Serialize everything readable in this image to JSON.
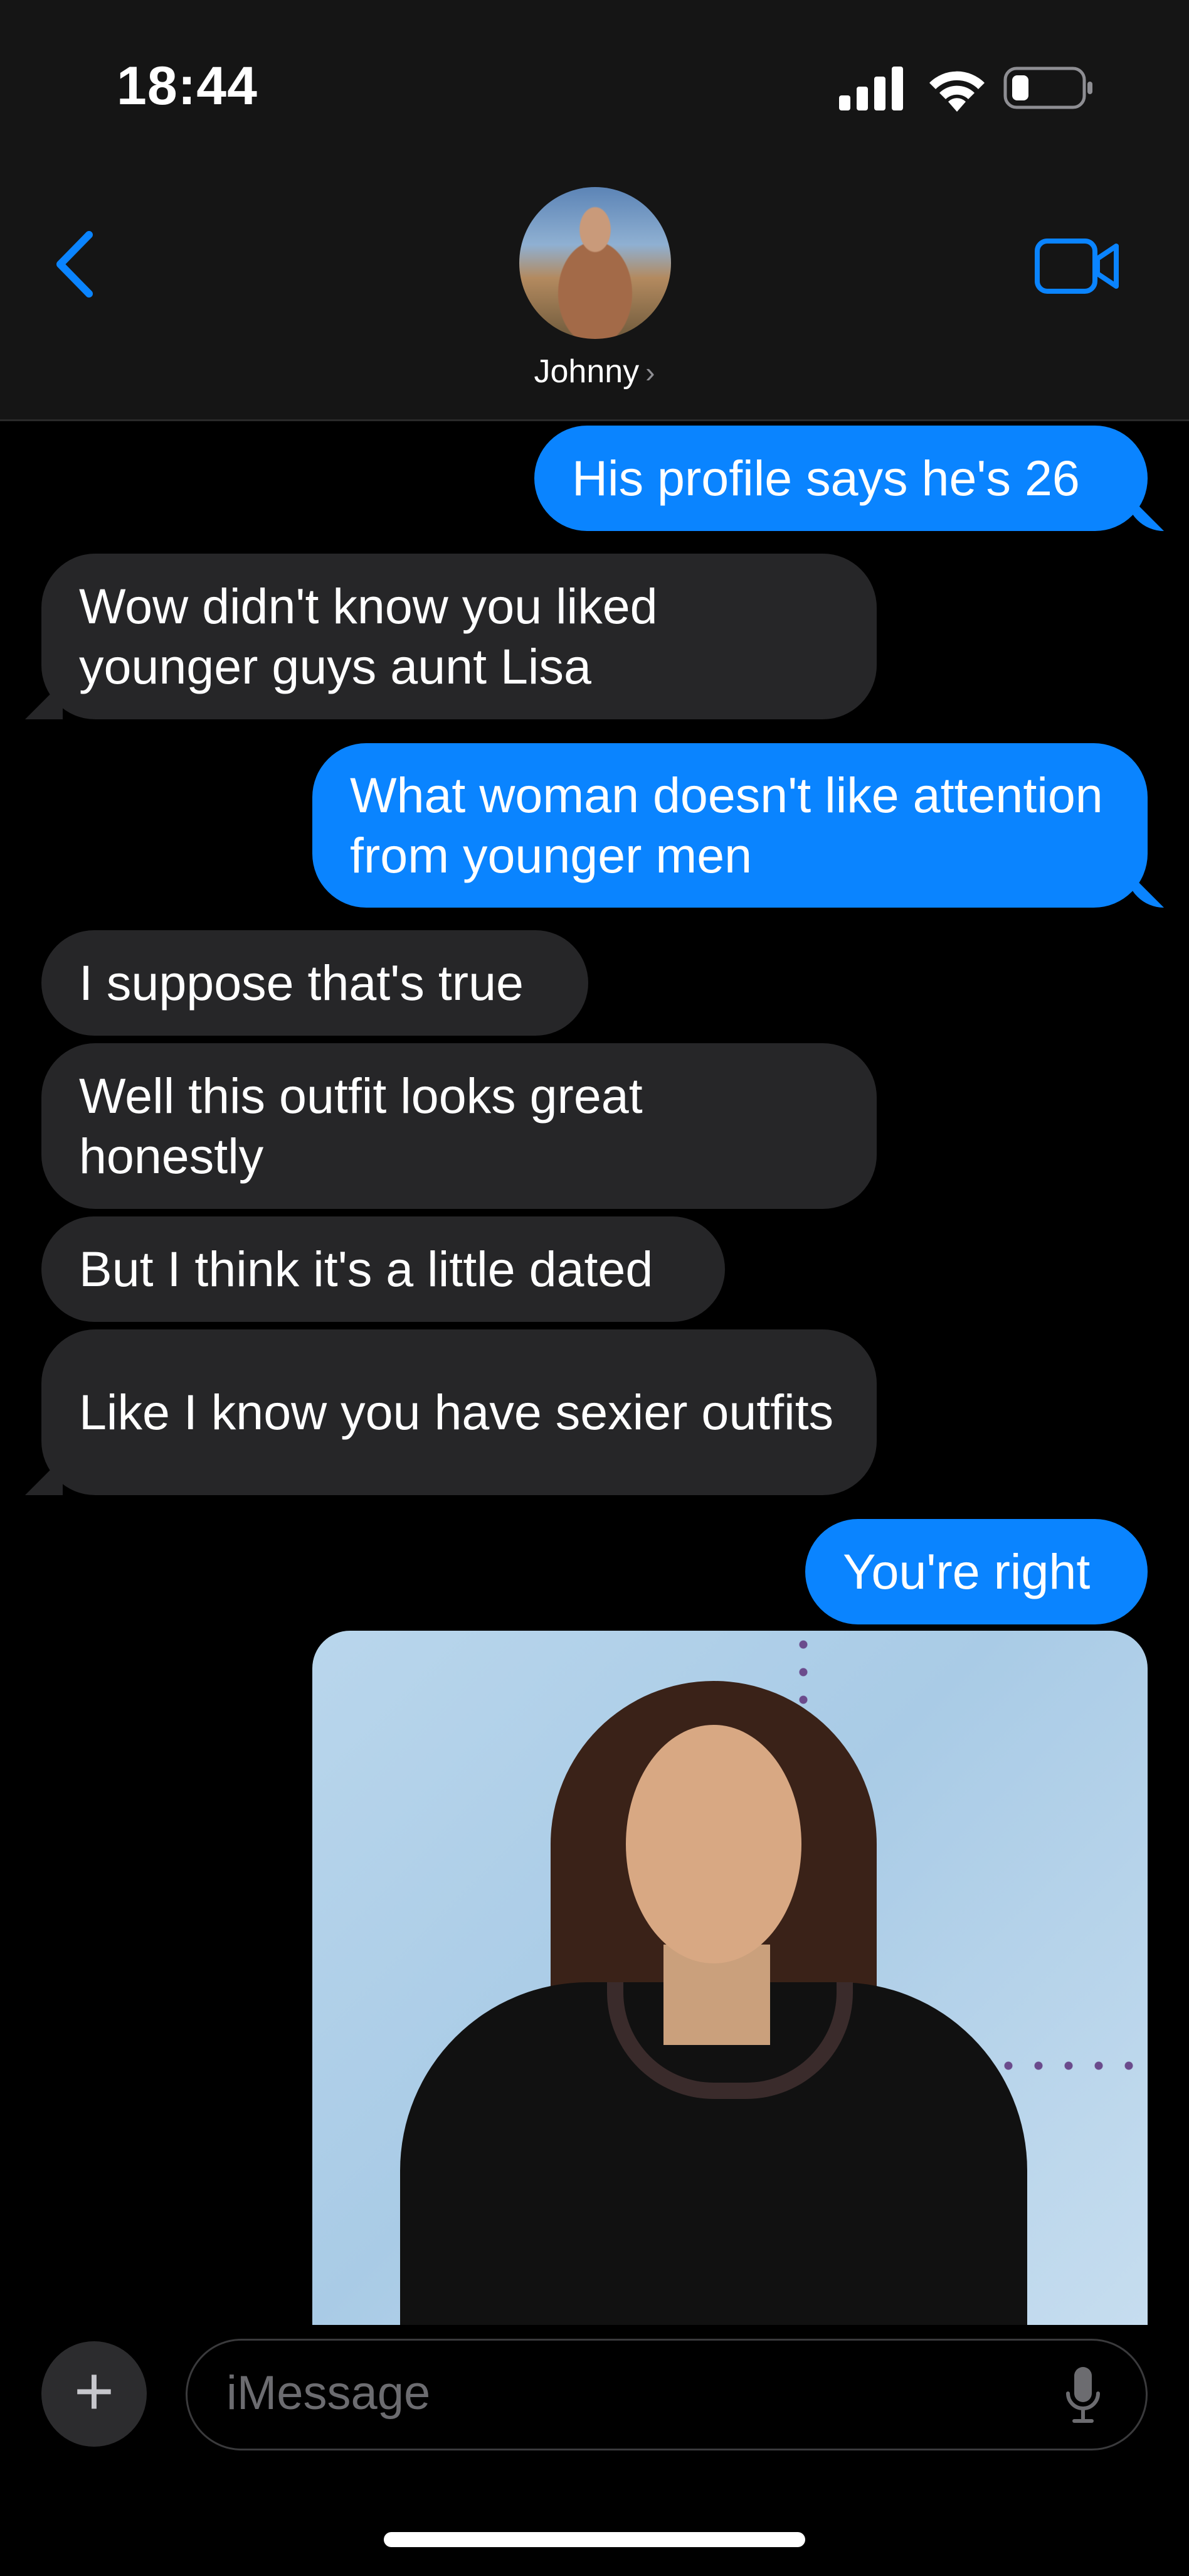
{
  "status_bar": {
    "time": "18:44"
  },
  "header": {
    "contact_name": "Johnny"
  },
  "messages": [
    {
      "direction": "outgoing",
      "text": "His profile says he's 26"
    },
    {
      "direction": "incoming",
      "text": "Wow didn't know you liked younger guys aunt Lisa"
    },
    {
      "direction": "outgoing",
      "text": "What woman doesn't like attention from younger men"
    },
    {
      "direction": "incoming",
      "text": "I suppose that's true"
    },
    {
      "direction": "incoming",
      "text": "Well this outfit looks great honestly"
    },
    {
      "direction": "incoming",
      "text": "But I think it's a little dated"
    },
    {
      "direction": "incoming",
      "text": "Like I know you have sexier outfits"
    },
    {
      "direction": "outgoing",
      "text": "You're right"
    }
  ],
  "composer": {
    "placeholder": "iMessage",
    "plus": "+"
  },
  "colors": {
    "outgoing": "#0a84ff",
    "incoming": "#262628",
    "header": "#151515"
  }
}
